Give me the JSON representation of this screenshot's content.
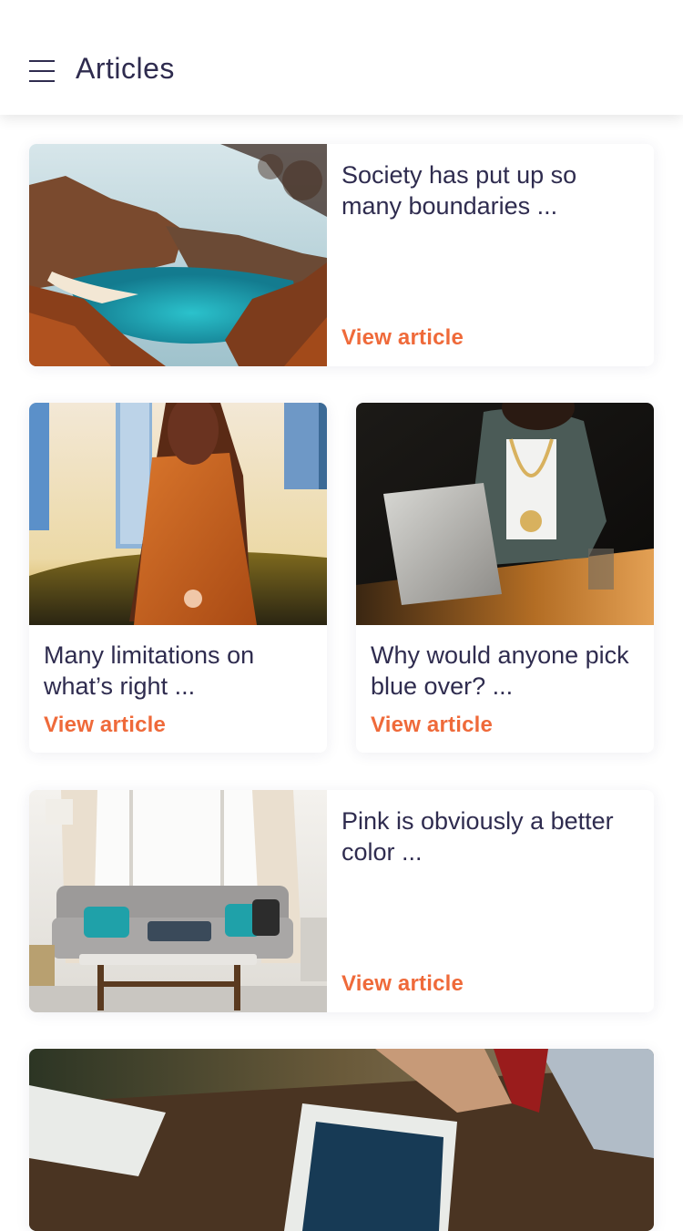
{
  "header": {
    "title": "Articles"
  },
  "articles": [
    {
      "title": "Society has put up so many boundaries ...",
      "link_label": "View article",
      "image": "coastal-cove-photo"
    },
    {
      "title": "Many limitations on what’s right ...",
      "link_label": "View article",
      "image": "woman-orange-coat-photo"
    },
    {
      "title": "Why would anyone pick blue over? ...",
      "link_label": "View article",
      "image": "woman-laptop-photo"
    },
    {
      "title": "Pink is obviously a better color ...",
      "link_label": "View article",
      "image": "living-room-sofa-photo"
    },
    {
      "title": "",
      "link_label": "",
      "image": "tablet-on-desk-photo"
    }
  ],
  "colors": {
    "accent": "#ef6a3a",
    "text": "#2f2c4f",
    "background": "#ffffff"
  }
}
